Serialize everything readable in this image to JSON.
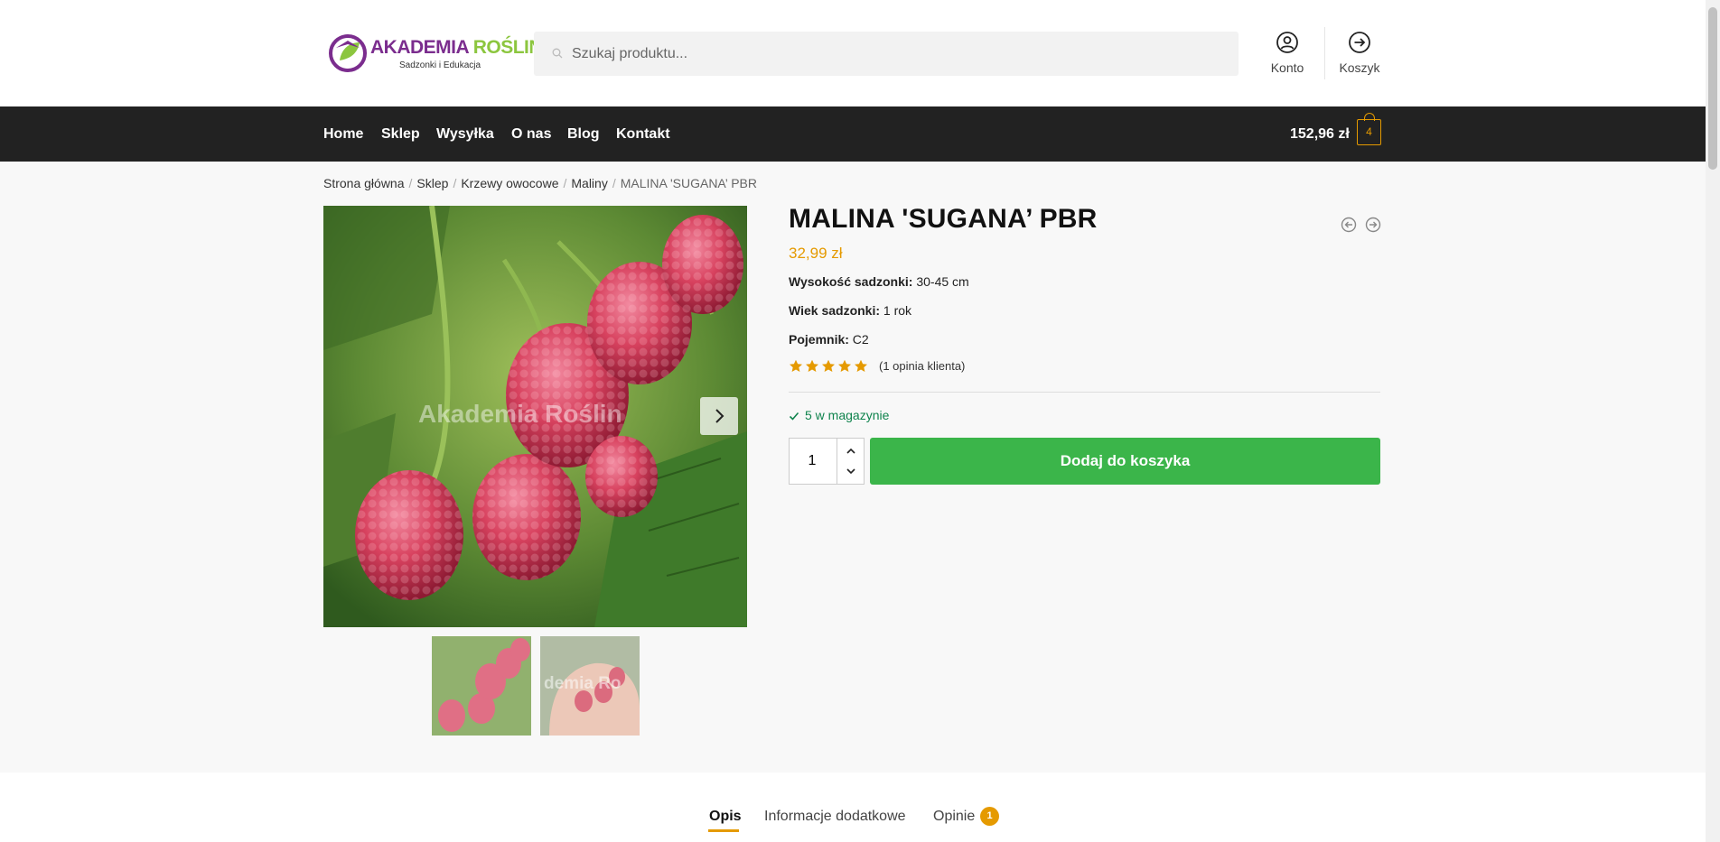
{
  "header": {
    "logo": {
      "name_part1": "AKADEMIA ",
      "name_part2": "ROŚLIN",
      "tagline": "Sadzonki i Edukacja"
    },
    "search": {
      "placeholder": "Szukaj produktu..."
    },
    "account_label": "Konto",
    "cart_label": "Koszyk"
  },
  "nav": {
    "items": [
      "Home",
      "Sklep",
      "Wysyłka",
      "O nas",
      "Blog",
      "Kontakt"
    ],
    "cart_total": "152,96 zł",
    "cart_count": "4"
  },
  "breadcrumb": [
    "Strona główna",
    "Sklep",
    "Krzewy owocowe",
    "Maliny",
    "MALINA 'SUGANA’ PBR"
  ],
  "gallery": {
    "watermark": "Akademia Roślin",
    "thumb_watermark": "demia Ro"
  },
  "product": {
    "title": "MALINA 'SUGANA’ PBR",
    "price": "32,99 zł",
    "attributes": [
      {
        "label": "Wysokość sadzonki:",
        "value": " 30-45 cm"
      },
      {
        "label": "Wiek sadzonki:",
        "value": " 1 rok"
      },
      {
        "label": "Pojemnik:",
        "value": " C2"
      }
    ],
    "rating_stars": 5,
    "reviews_text": "(1 opinia klienta)",
    "stock": "5 w magazynie",
    "quantity": "1",
    "add_to_cart": "Dodaj do koszyka"
  },
  "tabs": {
    "items": [
      "Opis",
      "Informacje dodatkowe",
      "Opinie"
    ],
    "reviews_count": "1"
  },
  "colors": {
    "accent": "#e59a00",
    "button_green": "#3bb54a",
    "nav_bg": "#222222",
    "stock_green": "#0f834d"
  }
}
